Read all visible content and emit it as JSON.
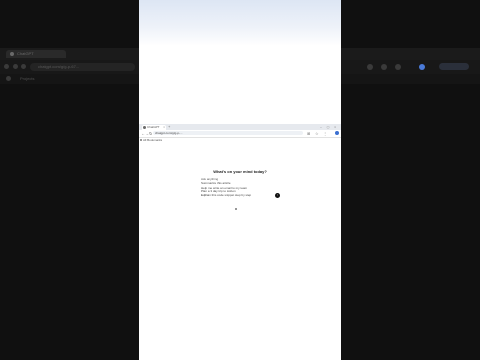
{
  "background": {
    "tab_label": "ChatGPT",
    "url": "chatgpt.com/g/g-p-67...",
    "bookmark": "Projects"
  },
  "browser": {
    "tab_label": "ChatGPT",
    "tab_close": "×",
    "new_tab": "+",
    "window_controls": "– ▢ ×",
    "back": "←",
    "forward": "→",
    "reload": "↻",
    "url": "chatgpt.com/g/g-p-...",
    "menu": "⋮",
    "bookmark_label": "All Bookmarks"
  },
  "page": {
    "title": "What's on your mind today?",
    "prompt_label": "Ask anything",
    "suggestions": [
      "Summarize this article",
      "Help me write an email to my team",
      "Plan a 3 day trip to Lisbon",
      "Explain this code snippet step by step"
    ],
    "footer_left": "+  ⚙",
    "send_icon": "↑"
  },
  "colors": {
    "pillar": "#101010",
    "accent": "#3b6fd1",
    "send_button": "#111111"
  }
}
